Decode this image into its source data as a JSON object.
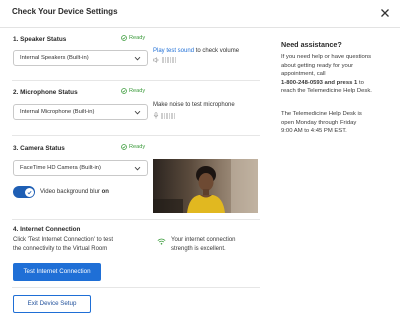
{
  "header": {
    "title": "Check Your Device Settings",
    "close_icon": "close-icon"
  },
  "speaker": {
    "title": "1. Speaker Status",
    "status": "Ready",
    "selected": "Internal Speakers (Built-in)",
    "link": "Play test sound",
    "suffix": " to check volume"
  },
  "microphone": {
    "title": "2. Microphone Status",
    "status": "Ready",
    "selected": "Internal Microphone (Built-in)",
    "hint": "Make noise to test microphone"
  },
  "camera": {
    "title": "3. Camera Status",
    "status": "Ready",
    "selected": "FaceTime HD Camera (Built-in)",
    "blur_label": "Video background blur",
    "blur_state": "on"
  },
  "internet": {
    "title": "4. Internet Connection",
    "instructions_line1": "Click 'Test Internet Connection' to test",
    "instructions_line2": "the connectivity to the Virtual Room",
    "result_line1": "Your internet connection",
    "result_line2": "strength is excellent.",
    "button": "Test Internet Connection"
  },
  "footer": {
    "exit_button": "Exit Device Setup"
  },
  "assistance": {
    "title": "Need assistance?",
    "p1_line1": "If you need help or have questions",
    "p1_line2": "about getting ready for your",
    "p1_line3": "appointment, call",
    "p1_phone": "1-800-248-0593 and press 1",
    "p1_line4_after": " to",
    "p1_line5": "reach the Telemedicine Help Desk.",
    "p2_line1": "The Telemedicine Help Desk is",
    "p2_line2": "open Monday through Friday",
    "p2_line3": "9:00 AM to 4:45 PM EST."
  },
  "colors": {
    "accent": "#1f6fd6",
    "ready": "#3a9b3a",
    "toggle": "#1f5fb4"
  }
}
